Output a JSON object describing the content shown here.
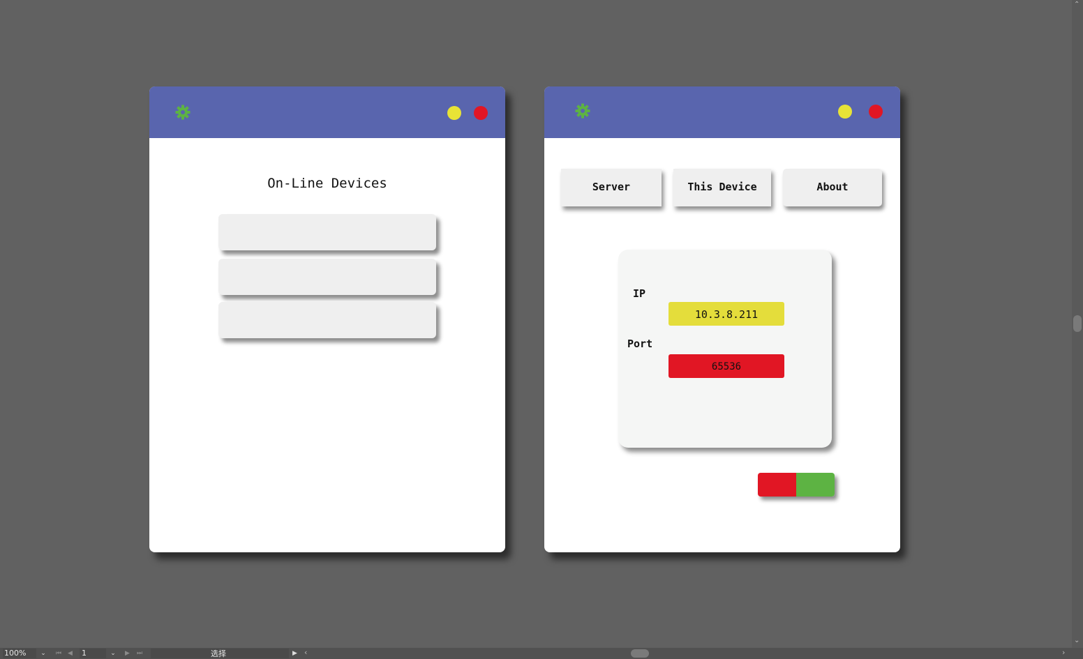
{
  "colors": {
    "background": "#616161",
    "titlebar": "#5965ae",
    "gear": "#5db343",
    "minimize": "#e8e336",
    "close": "#e11624",
    "ip_field": "#e4dd3b",
    "port_field": "#e11624",
    "toggle_left": "#e11624",
    "toggle_right": "#5db343"
  },
  "left_window": {
    "heading": "On-Line Devices",
    "device_items": [
      "",
      "",
      ""
    ],
    "icons": [
      "gear-icon",
      "minimize-dot",
      "close-dot"
    ]
  },
  "right_window": {
    "tabs": [
      {
        "label": "Server"
      },
      {
        "label": "This Device"
      },
      {
        "label": "About"
      }
    ],
    "ip_label": "IP",
    "ip_value": "10.3.8.211",
    "port_label": "Port",
    "port_value": "65536",
    "icons": [
      "gear-icon",
      "minimize-dot",
      "close-dot"
    ]
  },
  "statusbar": {
    "zoom": "100%",
    "page": "1",
    "mode": "选择"
  }
}
